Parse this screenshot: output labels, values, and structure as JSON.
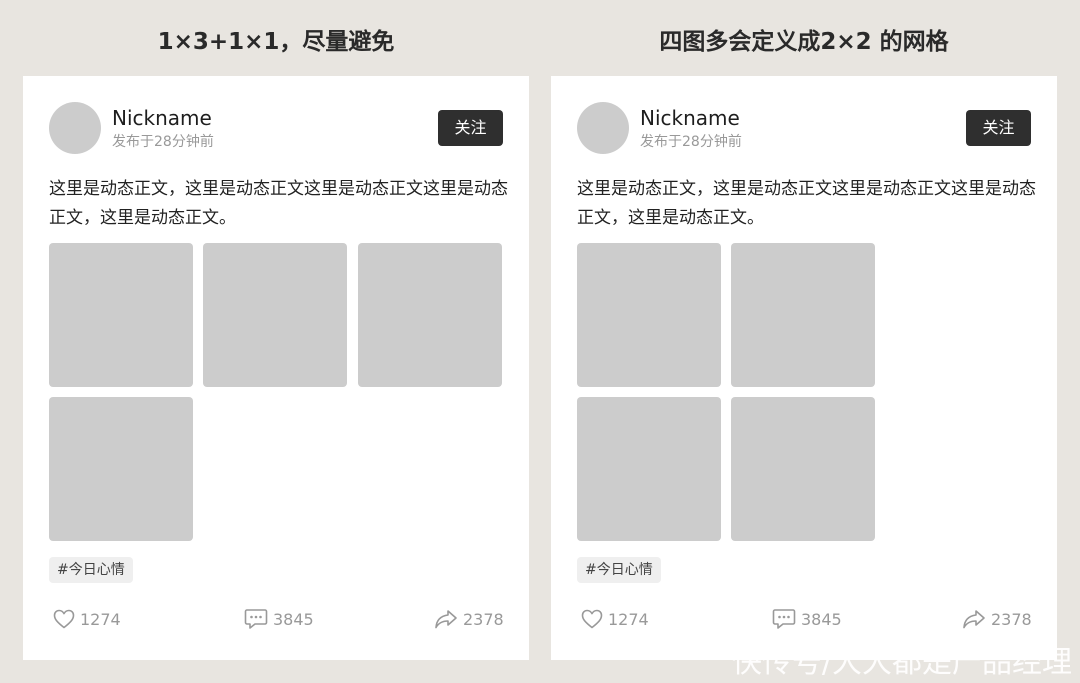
{
  "columns": [
    {
      "title": "1×3+1×1，尽量避免",
      "card": {
        "nickname": "Nickname",
        "post_time": "发布于28分钟前",
        "follow_label": "关注",
        "body_text": "这里是动态正文，这里是动态正文这里是动态正文这里是动态正文，这里是动态正文。",
        "tag": "#今日心情",
        "likes": "1274",
        "comments": "3845",
        "shares": "2378"
      }
    },
    {
      "title": "四图多会定义成2×2 的网格",
      "card": {
        "nickname": "Nickname",
        "post_time": "发布于28分钟前",
        "follow_label": "关注",
        "body_text": "这里是动态正文，这里是动态正文这里是动态正文这里是动态正文，这里是动态正文。",
        "tag": "#今日心情",
        "likes": "1274",
        "comments": "3845",
        "shares": "2378"
      }
    }
  ],
  "watermark": "快传号/大大都是产品经理",
  "icons": {
    "like": "heart-icon",
    "comment": "comment-bubble-icon",
    "share": "share-arrow-icon"
  },
  "colors": {
    "background": "#e8e5e0",
    "card": "#ffffff",
    "placeholder": "#cccccc",
    "follow_button": "#2f2f2f",
    "secondary_text": "#999999"
  }
}
